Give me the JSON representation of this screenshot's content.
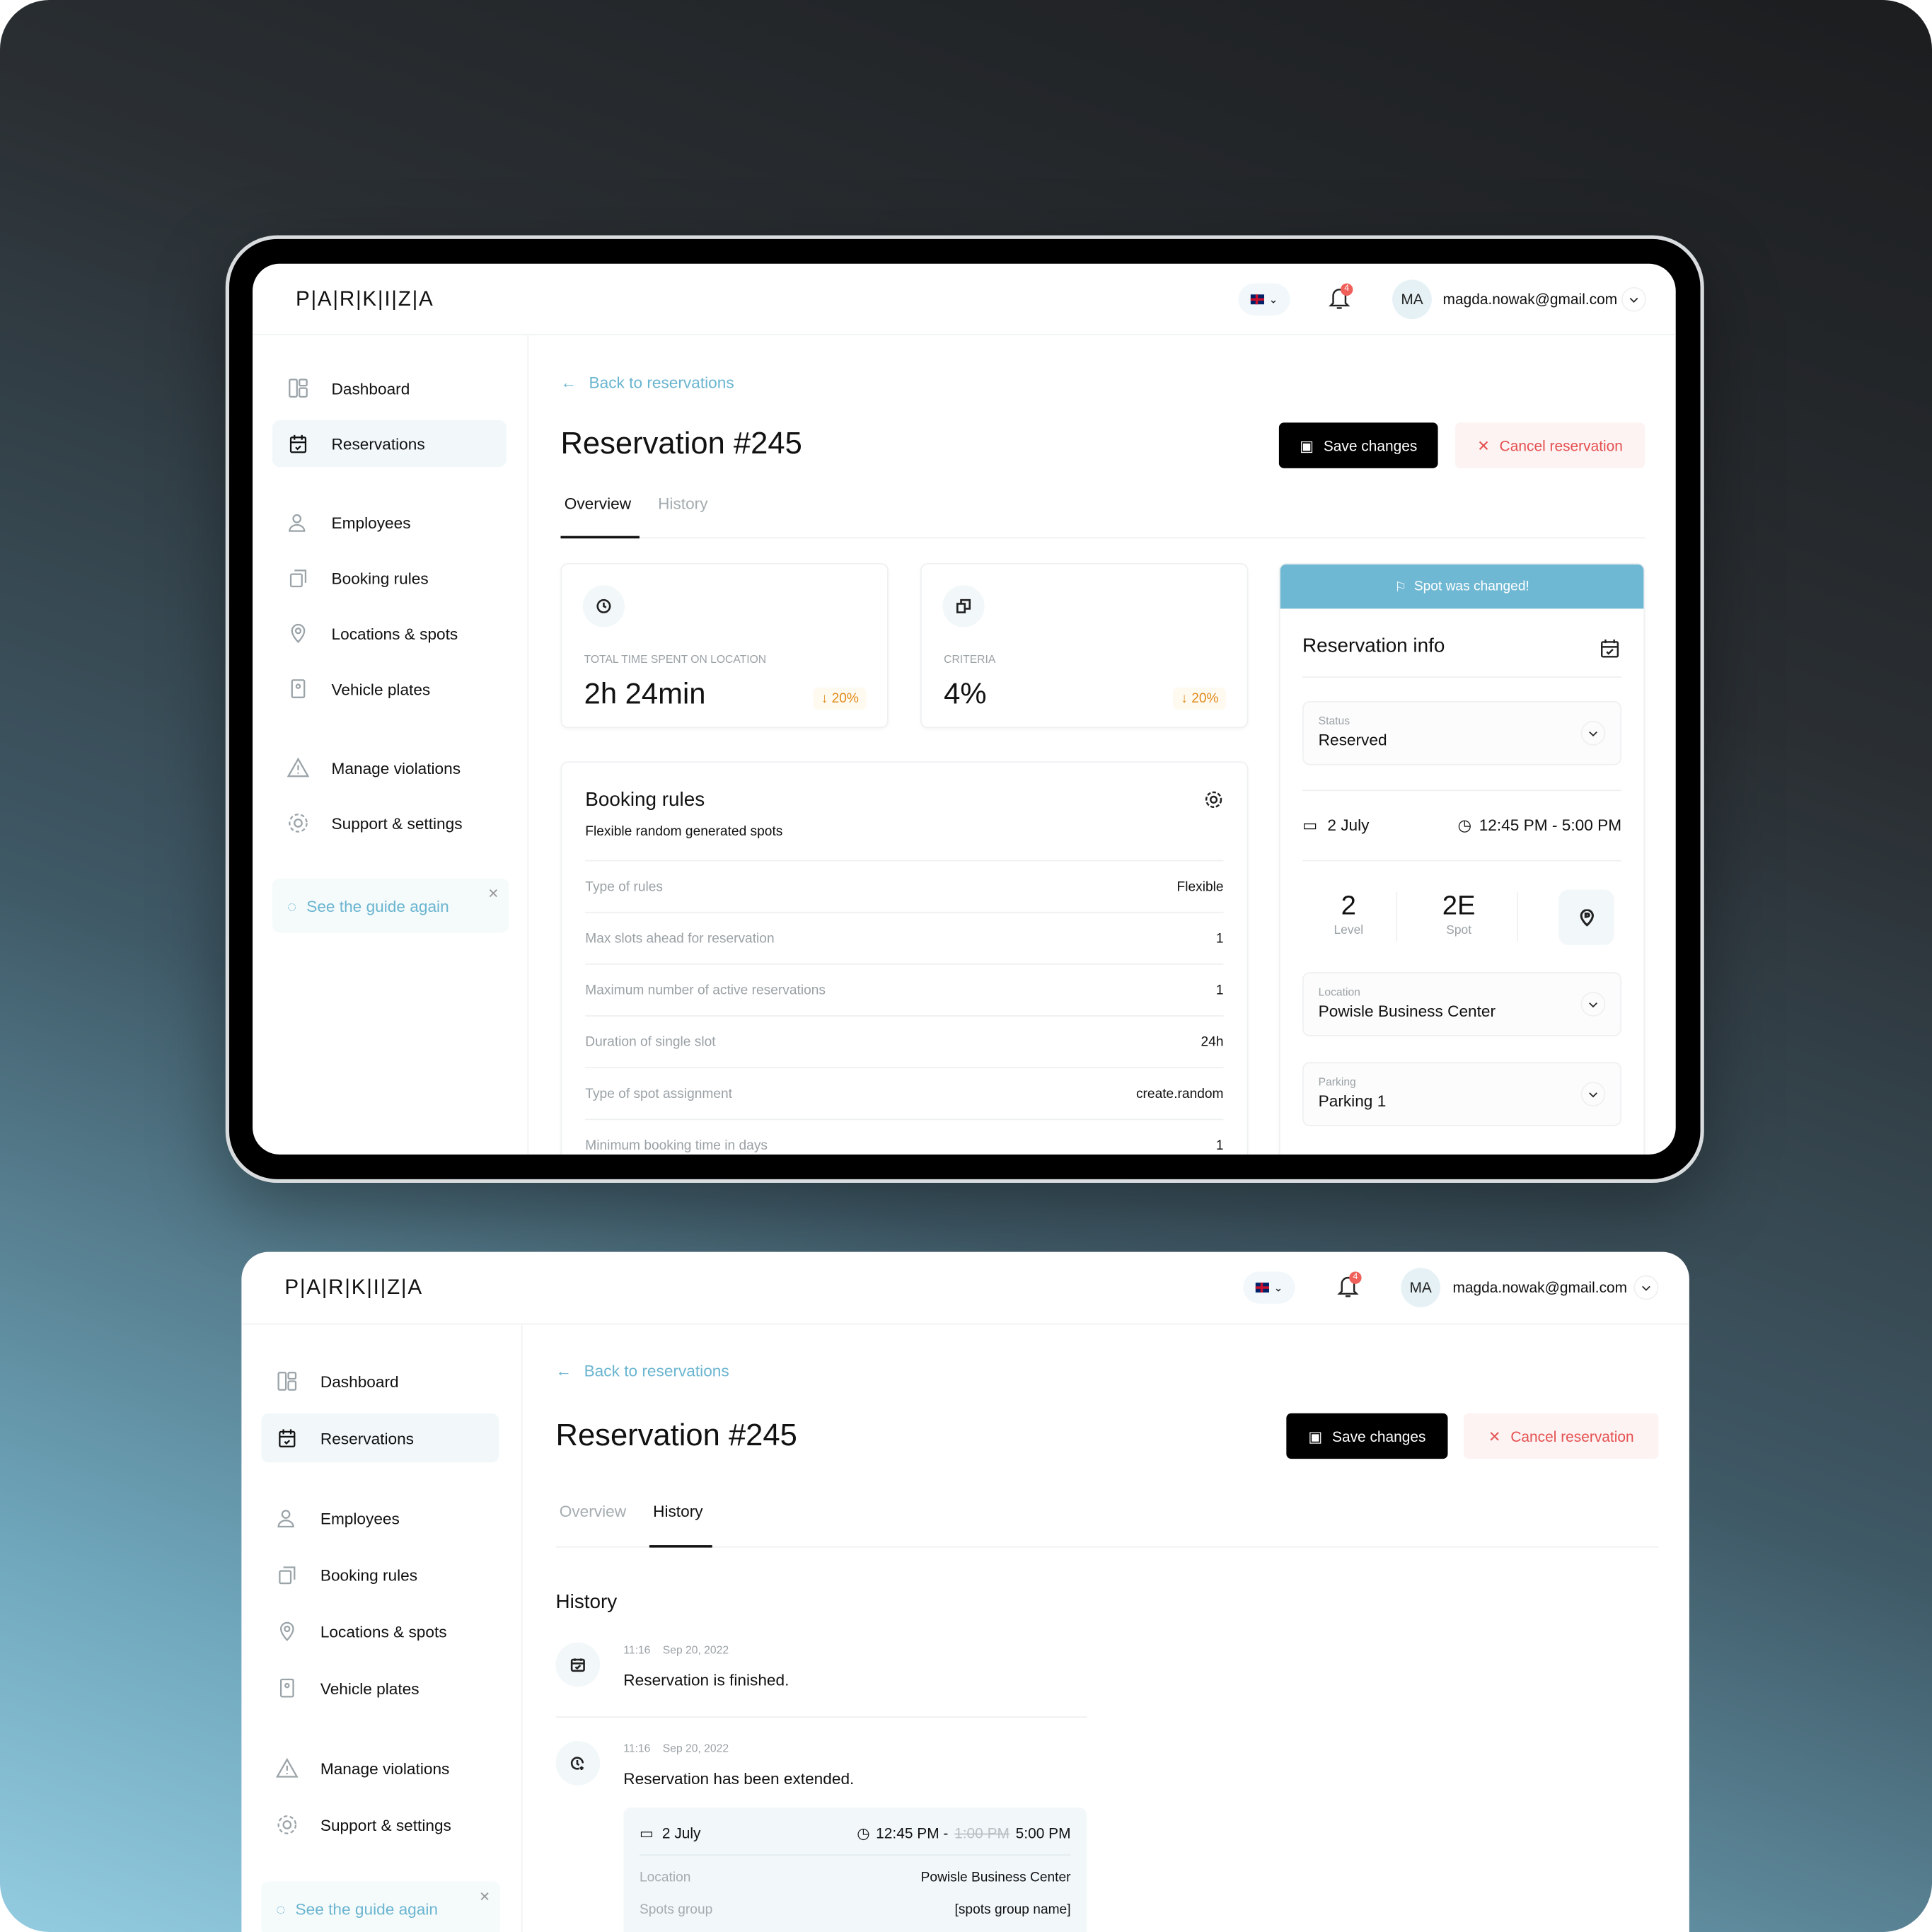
{
  "app": {
    "logo": "P|A|R|K|I|Z|A",
    "notification_count": "4",
    "user_initials": "MA",
    "user_email": "magda.nowak@gmail.com"
  },
  "sidebar": {
    "items": [
      {
        "label": "Dashboard",
        "icon": "dashboard-icon"
      },
      {
        "label": "Reservations",
        "icon": "calendar-check-icon",
        "active": true
      },
      {
        "label": "Employees",
        "icon": "users-icon"
      },
      {
        "label": "Booking rules",
        "icon": "booking-rules-icon"
      },
      {
        "label": "Locations & spots",
        "icon": "location-pin-icon"
      },
      {
        "label": "Vehicle plates",
        "icon": "plate-icon"
      },
      {
        "label": "Manage violations",
        "icon": "warning-icon"
      },
      {
        "label": "Support & settings",
        "icon": "gear-icon"
      }
    ],
    "guide": "See the guide again"
  },
  "page": {
    "back": "Back to reservations",
    "title": "Reservation #245",
    "save": "Save changes",
    "cancel": "Cancel reservation",
    "tabs": [
      "Overview",
      "History"
    ]
  },
  "overview": {
    "stats": [
      {
        "label": "TOTAL TIME SPENT ON LOCATION",
        "value": "2h 24min",
        "delta": "↓ 20%"
      },
      {
        "label": "CRITERIA",
        "value": "4%",
        "delta": "↓ 20%"
      }
    ],
    "booking_rules": {
      "title": "Booking rules",
      "subtitle": "Flexible random generated spots",
      "rows": [
        [
          "Type of rules",
          "Flexible"
        ],
        [
          "Max slots ahead for reservation",
          "1"
        ],
        [
          "Maximum number of active reservations",
          "1"
        ],
        [
          "Duration of single slot",
          "24h"
        ],
        [
          "Type of spot assignment",
          "create.random"
        ],
        [
          "Minimum booking time in days",
          "1"
        ]
      ]
    },
    "info": {
      "banner": "Spot was changed!",
      "title": "Reservation info",
      "status_label": "Status",
      "status": "Reserved",
      "date": "2 July",
      "time": "12:45 PM - 5:00 PM",
      "level": "2",
      "level_label": "Level",
      "spot": "2E",
      "spot_label": "Spot",
      "location_label": "Location",
      "location": "Powisle Business Center",
      "parking_label": "Parking",
      "parking": "Parking 1"
    }
  },
  "history": {
    "title": "History",
    "items": [
      {
        "time": "11:16",
        "date": "Sep 20, 2022",
        "text": "Reservation is finished.",
        "icon": "calendar-check-icon"
      },
      {
        "time": "11:16",
        "date": "Sep 20, 2022",
        "text": "Reservation has been extended.",
        "icon": "clock-plus-icon",
        "detail": {
          "date": "2 July",
          "time_start": "12:45 PM -",
          "time_old": "1:00 PM",
          "time_new": "5:00 PM",
          "location_label": "Location",
          "location": "Powisle Business Center",
          "group_label": "Spots group",
          "group": "[spots group name]"
        }
      }
    ]
  },
  "colors": {
    "accent": "#6ab5d0",
    "danger": "#e55050",
    "warning": "#e08a1a"
  }
}
